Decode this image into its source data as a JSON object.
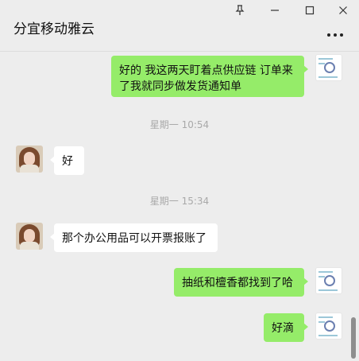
{
  "window": {
    "title": "分宜移动雅云",
    "controls": {
      "pin_icon": "pin-icon",
      "minimize_icon": "minimize-icon",
      "maximize_icon": "maximize-icon",
      "close_icon": "close-icon",
      "more_icon": "more-dots-icon"
    }
  },
  "messages": [
    {
      "sender": "me",
      "text": "好的 我这两天盯着点供应链 订单来\n了我就同步做发货通知单"
    },
    {
      "time": "星期一 10:54"
    },
    {
      "sender": "other",
      "text": "好"
    },
    {
      "time": "星期一 15:34"
    },
    {
      "sender": "other",
      "text": "那个办公用品可以开票报账了"
    },
    {
      "sender": "me",
      "text": "抽纸和檀香都找到了哈"
    },
    {
      "sender": "me",
      "text": "好滴"
    }
  ],
  "colors": {
    "background": "#ededed",
    "my_bubble": "#95ec69",
    "other_bubble": "#ffffff",
    "timestamp": "#a9a9a9"
  }
}
